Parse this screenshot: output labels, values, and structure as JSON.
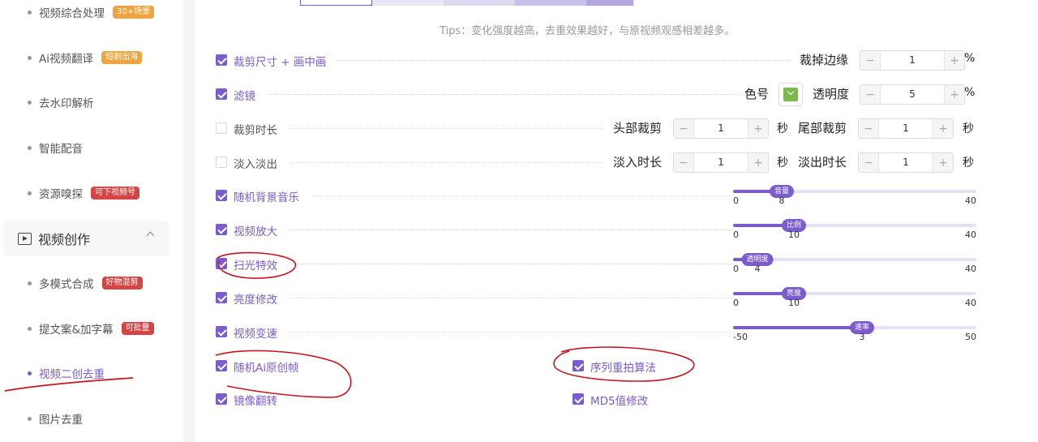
{
  "sidebar": {
    "items": [
      {
        "label": "视频综合处理",
        "badge": "30+场景",
        "badge_color": "orange"
      },
      {
        "label": "Ai视频翻译",
        "badge": "短剧出海",
        "badge_color": "orange"
      },
      {
        "label": "去水印解析",
        "badge": ""
      },
      {
        "label": "智能配音",
        "badge": ""
      },
      {
        "label": "资源嗅探",
        "badge": "可下视频号",
        "badge_color": "red"
      }
    ],
    "group": {
      "label": "视频创作",
      "expanded": true
    },
    "sub_items": [
      {
        "label": "多模式合成",
        "badge": "好物混剪",
        "active": false
      },
      {
        "label": "提文案&加字幕",
        "badge": "可批量",
        "active": false
      },
      {
        "label": "视频二创去重",
        "badge": "",
        "active": true
      },
      {
        "label": "图片去重",
        "badge": "",
        "active": false
      }
    ]
  },
  "tips": "Tips：变化强度越高，去重效果越好，与原视频观感相差越多。",
  "options": {
    "crop_pip": {
      "label": "裁剪尺寸 + 画中画",
      "checked": true,
      "control_label": "裁掉边缘",
      "value": "1",
      "unit": "%"
    },
    "filter": {
      "label": "滤镜",
      "checked": true,
      "color_label": "色号",
      "color": "#7bb94c",
      "opacity_label": "透明度",
      "value": "5",
      "unit": "%"
    },
    "trim": {
      "label": "裁剪时长",
      "checked": false,
      "head_label": "头部裁剪",
      "head_value": "1",
      "head_unit": "秒",
      "tail_label": "尾部裁剪",
      "tail_value": "1",
      "tail_unit": "秒"
    },
    "fade": {
      "label": "淡入淡出",
      "checked": false,
      "in_label": "淡入时长",
      "in_value": "1",
      "in_unit": "秒",
      "out_label": "淡出时长",
      "out_value": "1",
      "out_unit": "秒"
    },
    "bgm": {
      "label": "随机背景音乐",
      "checked": true,
      "knob": "音量",
      "min": "0",
      "max": "40",
      "value": "8",
      "fraction": 0.2
    },
    "zoom": {
      "label": "视频放大",
      "checked": true,
      "knob": "比例",
      "min": "0",
      "max": "40",
      "value": "10",
      "fraction": 0.25
    },
    "sweep": {
      "label": "扫光特效",
      "checked": true,
      "knob": "透明度",
      "min": "0",
      "max": "40",
      "value": "4",
      "fraction": 0.1
    },
    "brightness": {
      "label": "亮度修改",
      "checked": true,
      "knob": "亮度",
      "min": "0",
      "max": "40",
      "value": "10",
      "fraction": 0.25
    },
    "speed": {
      "label": "视频变速",
      "checked": true,
      "knob": "速率",
      "min": "-50",
      "max": "50",
      "value": "3",
      "fraction": 0.53
    },
    "random_frame": {
      "label": "随机Ai原创帧",
      "checked": true
    },
    "reorder": {
      "label": "序列重拍算法",
      "checked": true
    },
    "mirror": {
      "label": "镜像翻转",
      "checked": true
    },
    "md5": {
      "label": "MD5值修改",
      "checked": true
    }
  },
  "stepper": {
    "minus": "−",
    "plus": "+"
  },
  "colors": {
    "accent": "#7b5ccc",
    "annotation": "#c8141e"
  }
}
